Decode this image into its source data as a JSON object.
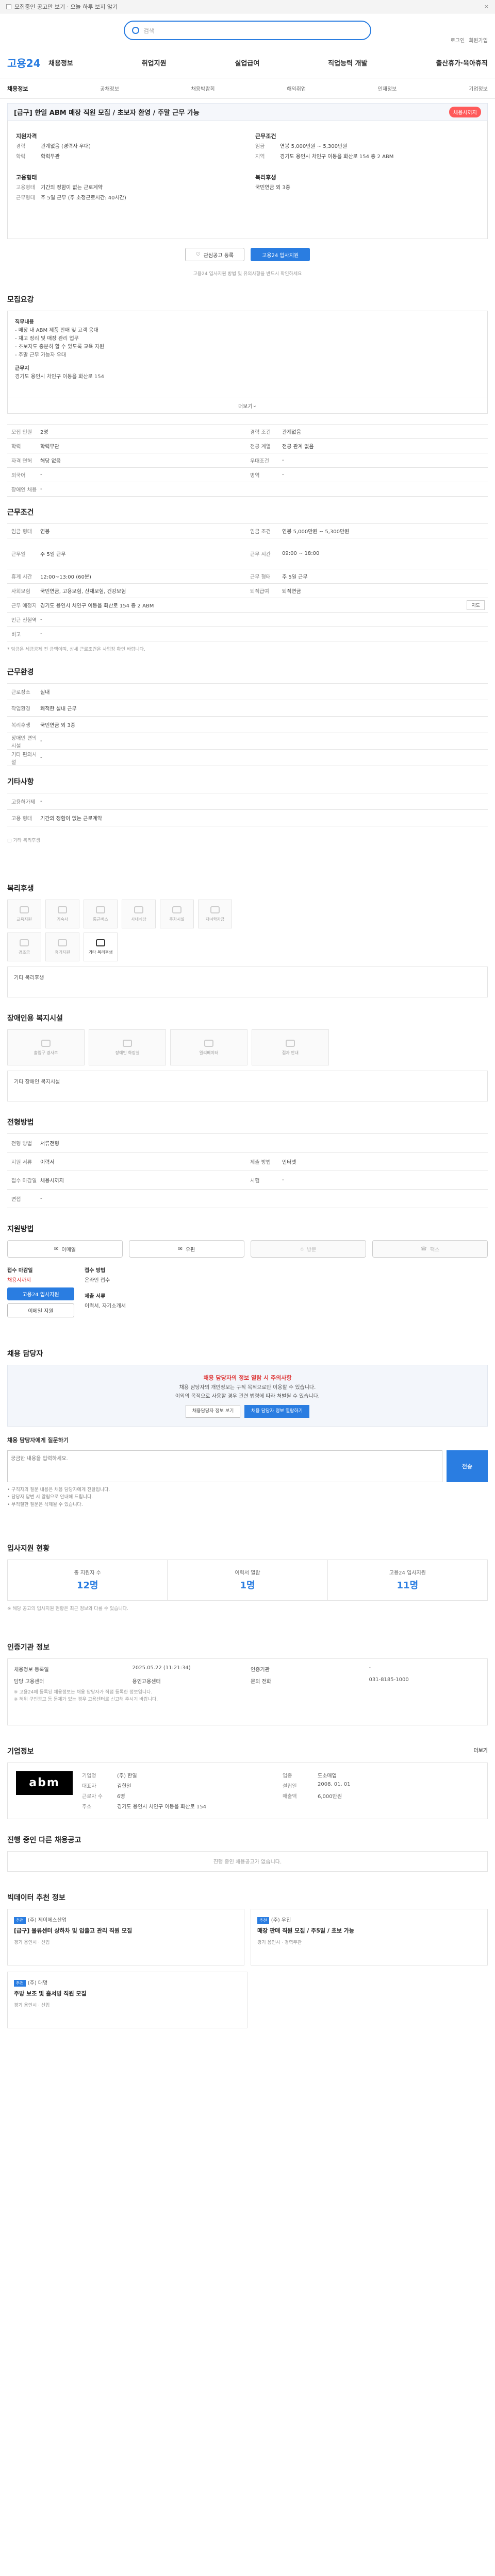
{
  "topbar": {
    "text": "모집중인 공고만 보기 · 오늘 하루 보지 않기",
    "close": "×"
  },
  "search": {
    "placeholder": "검색"
  },
  "header_links": [
    "로그인",
    "회원가입"
  ],
  "gnb": {
    "logo": "고용24",
    "menu": [
      "채용정보",
      "취업지원",
      "실업급여",
      "직업능력 개발",
      "출산휴가·육아휴직"
    ]
  },
  "subnav": [
    "채용정보",
    "공채정보",
    "채용박람회",
    "해외취업",
    "인재정보",
    "기업정보"
  ],
  "job": {
    "title": "[급구] 한일 ABM 매장 직원 모집 / 초보자 환영 / 주말 근무 가능",
    "badge": "채용시까지",
    "recruit_label": "지원자격",
    "recruit": [
      [
        "경력",
        "관계없음 (경력자 우대)"
      ],
      [
        "학력",
        "학력무관"
      ]
    ],
    "cond_label": "근무조건",
    "cond": [
      [
        "임금",
        "연봉 5,000만원 ~ 5,300만원"
      ],
      [
        "지역",
        "경기도 용인시 처인구 이동읍 화산로 154 층 2 ABM"
      ]
    ],
    "form_label": "고용형태",
    "form": [
      [
        "고용형태",
        "기간의 정함이 없는 근로계약"
      ],
      [
        "근무형태",
        "주 5일 근무 (주 소정근로시간: 40시간)"
      ]
    ],
    "welfare_label": "복리후생",
    "welfare": "국민연금 외 3종"
  },
  "actions": {
    "scrap": "관심공고 등록",
    "apply": "고용24 입사지원"
  },
  "notice": "고용24 입사지원 방법 및 유의사항을 반드시 확인하세요",
  "detail": {
    "title": "모집요강",
    "h1": "직무내용",
    "lines": [
      "- 매장 내 ABM 제품 판매 및 고객 응대",
      "- 재고 정리 및 매장 관리 업무",
      "- 초보자도 충분히 할 수 있도록 교육 지원",
      "- 주말 근무 가능자 우대"
    ],
    "h2": "근무지",
    "addr": "경기도 용인시 처인구 이동읍 화산로 154",
    "more": "더보기"
  },
  "req_rows": [
    [
      "모집 인원",
      "2명",
      "경력 조건",
      "관계없음"
    ],
    [
      "학력",
      "학력무관",
      "전공 계열",
      "전공 관계 없음"
    ],
    [
      "자격 면허",
      "해당 없음",
      "우대조건",
      "-"
    ],
    [
      "외국어",
      "-",
      "병역",
      "-"
    ],
    [
      "장애인 채용",
      "-",
      "",
      ""
    ]
  ],
  "cond_title": "근무조건",
  "cond_rows": [
    [
      "임금 형태",
      "연봉",
      "임금 조건",
      "연봉 5,000만원 ~ 5,300만원"
    ],
    [
      "근무일",
      "주 5일 근무",
      "근무 시간",
      "09:00 ~ 18:00"
    ],
    [
      "휴게 시간",
      "12:00~13:00 (60분)",
      "근무 형태",
      "주 5일 근무"
    ],
    [
      "사회보험",
      "국민연금, 고용보험, 산재보험, 건강보험",
      "퇴직급여",
      "퇴직연금"
    ],
    [
      "근무 예정지",
      "경기도 용인시 처인구 이동읍 화산로 154 층 2 ABM",
      "",
      ""
    ],
    [
      "인근 전철역",
      "-",
      "",
      ""
    ],
    [
      "비고",
      "-",
      "",
      ""
    ]
  ],
  "cond_note": "* 임금은 세금공제 전 금액이며, 상세 근로조건은 사업장 확인 바랍니다.",
  "env_title": "근무환경",
  "env_rows": [
    [
      "근로장소",
      "실내"
    ],
    [
      "작업환경",
      "쾌적한 실내 근무"
    ],
    [
      "복리후생",
      "국민연금 외 3종"
    ],
    [
      "장애인 편의시설",
      "-"
    ],
    [
      "기타 편의시설",
      "-"
    ]
  ],
  "etc_title": "기타사항",
  "etc_rows": [
    [
      "고용허가제",
      "-"
    ],
    [
      "고용 형태",
      "기간의 정함이 없는 근로계약"
    ]
  ],
  "facility_title": "복리후생",
  "facilities": [
    "교육지원",
    "기숙사",
    "통근버스",
    "사내식당",
    "주차시설",
    "자녀학자금",
    "경조금",
    "휴가지원",
    "기타 복리후생"
  ],
  "facility_sub_title": "기타 복리후생",
  "dis_title": "장애인용 복지시설",
  "dis_items": [
    "출입구 경사로",
    "장애인 화장실",
    "엘리베이터",
    "점자 안내"
  ],
  "dis_sub_title": "기타 장애인 복지시설",
  "screen_title": "전형방법",
  "screen_rows": [
    [
      "전형 방법",
      "서류전형",
      "",
      ""
    ],
    [
      "지원 서류",
      "이력서",
      "제출 방법",
      "인터넷"
    ],
    [
      "접수 마감일",
      "채용시까지",
      "시험",
      "-"
    ],
    [
      "면접",
      "-",
      "",
      ""
    ]
  ],
  "apply_title": "지원방법",
  "apply_btns": [
    "이메일",
    "우편",
    "방문",
    "팩스"
  ],
  "apply_info": {
    "h": "접수 마감일",
    "date": "채용시까지",
    "apply_btn": "고용24 입사지원",
    "email_btn": "이메일 지원",
    "h2": "접수 방법",
    "method": "온라인 접수",
    "h3": "제출 서류",
    "docs": "이력서, 자기소개서"
  },
  "manager_title": "채용 담당자",
  "warn": {
    "title": "채용 담당자의 정보 열람 시 주의사항",
    "l1": "채용 담당자의 개인정보는 구직 목적으로만 이용할 수 있습니다.",
    "l2": "이외의 목적으로 사용할 경우 관련 법령에 따라 처벌될 수 있습니다.",
    "b1": "채용담당자 정보 보기",
    "b2": "채용 담당자 정보 열람하기"
  },
  "qa": {
    "title": "채용 담당자에게 질문하기",
    "placeholder": "궁금한 내용을 입력하세요.",
    "submit": "전송",
    "list": [
      "• 구직자의 질문 내용은 채용 담당자에게 전달됩니다.",
      "• 담당자 답변 시 알림으로 안내해 드립니다.",
      "• 부적절한 질문은 삭제될 수 있습니다."
    ]
  },
  "stats_title": "입사지원 현황",
  "stats": [
    [
      "총 지원자 수",
      "12명"
    ],
    [
      "이력서 열람",
      "1명"
    ],
    [
      "고용24 입사지원",
      "11명"
    ]
  ],
  "stats_note": "※ 해당 공고의 입사지원 현황은 최근 정보와 다를 수 있습니다.",
  "cert_title": "인증기관 정보",
  "cert_rows": [
    [
      "채용정보 등록일",
      "2025.05.22 (11:21:34)",
      "인증기관",
      "-"
    ],
    [
      "담당 고용센터",
      "용인고용센터",
      "문의 전화",
      "031-8185-1000"
    ]
  ],
  "cert_notes": [
    "※ 고용24에 등록된 채용정보는 채용 담당자가 직접 등록한 정보입니다.",
    "※ 허위 구인광고 등 문제가 있는 경우 고용센터로 신고해 주시기 바랍니다."
  ],
  "comp_title": "기업정보",
  "comp": {
    "logo": "abm",
    "rows": [
      [
        "기업명",
        "(주) 한일",
        "업종",
        "도소매업"
      ],
      [
        "대표자",
        "김한일",
        "설립일",
        "2008. 01. 01"
      ],
      [
        "근로자 수",
        "6명",
        "매출액",
        "6,000만원"
      ],
      [
        "주소",
        "경기도 용인시 처인구 이동읍 화산로 154",
        "",
        ""
      ]
    ]
  },
  "other_title": "진행 중인 다른 채용공고",
  "other_empty": "진행 중인 채용공고가 없습니다.",
  "recommend_title": "빅데이터 추천 정보",
  "recommend": [
    {
      "tag": "추천",
      "company": "(주) 제이에스산업",
      "title": "[급구] 물류센터 상하차 및 입출고 관리 직원 모집",
      "meta": "경기 용인시 · 신입"
    },
    {
      "tag": "추천",
      "company": "(주) 우진",
      "title": "매장 판매 직원 모집 / 주5일 / 초보 가능",
      "meta": "경기 용인시 · 경력무관"
    },
    {
      "tag": "추천",
      "company": "(주) 대명",
      "title": "주방 보조 및 홀서빙 직원 모집",
      "meta": "경기 용인시 · 신입"
    }
  ],
  "more_label": "더보기"
}
